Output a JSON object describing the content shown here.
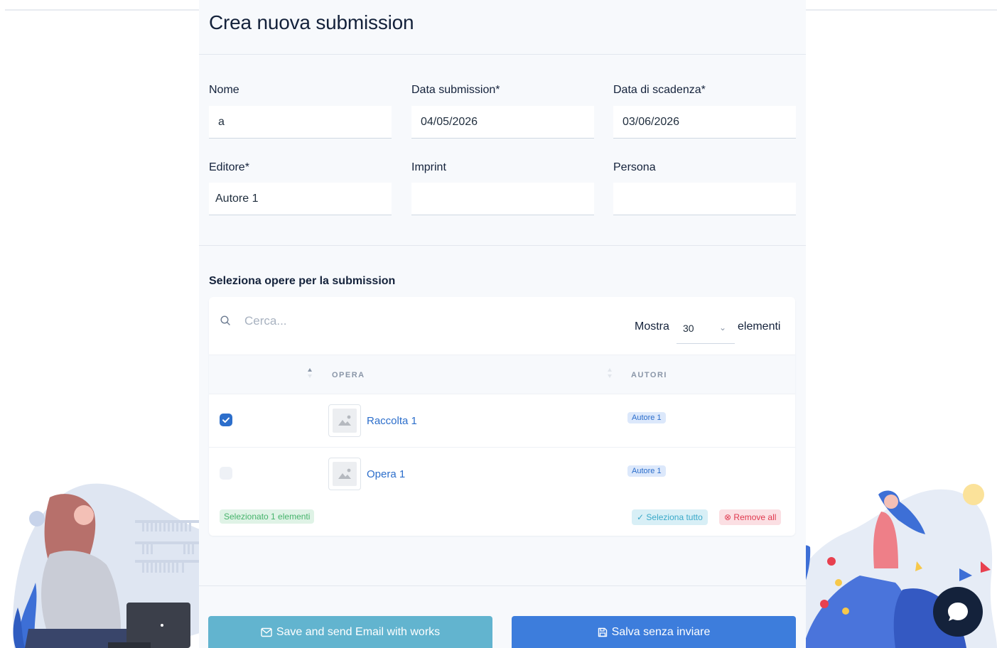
{
  "page": {
    "title": "Crea nuova submission"
  },
  "form": {
    "nome": {
      "label": "Nome",
      "value": "a"
    },
    "data_submission": {
      "label": "Data submission*",
      "value": "04/05/2026"
    },
    "data_scadenza": {
      "label": "Data di scadenza*",
      "value": "03/06/2026"
    },
    "editore": {
      "label": "Editore*",
      "value": "Autore 1"
    },
    "imprint": {
      "label": "Imprint",
      "value": ""
    },
    "persona": {
      "label": "Persona",
      "value": ""
    }
  },
  "works": {
    "section_title": "Seleziona opere per la submission",
    "search_placeholder": "Cerca...",
    "page_size": {
      "prefix": "Mostra",
      "value": "30",
      "suffix": "elementi"
    },
    "columns": [
      "OPERA",
      "AUTORI"
    ],
    "rows": [
      {
        "title": "Raccolta 1",
        "author": "Autore 1",
        "selected": true
      },
      {
        "title": "Opera 1",
        "author": "Autore 1",
        "selected": false
      }
    ],
    "selected_count_label": "Selezionato 1 elementi",
    "select_all_label": "Seleziona tutto",
    "remove_all_label": "Remove all"
  },
  "actions": {
    "send_email_label": "Save and send Email with works",
    "save_label": "Salva senza inviare"
  },
  "colors": {
    "primary": "#3d7ddc",
    "info": "#62b4cf",
    "success": "#45b36b",
    "danger": "#e0394f",
    "dark": "#14223b"
  },
  "icons": {
    "search": "search-icon",
    "chevron": "chevron-down-icon",
    "check": "check-icon",
    "image": "image-placeholder-icon",
    "envelope": "envelope-icon",
    "floppy": "floppy-disk-icon",
    "chat": "chat-bubble-icon"
  }
}
